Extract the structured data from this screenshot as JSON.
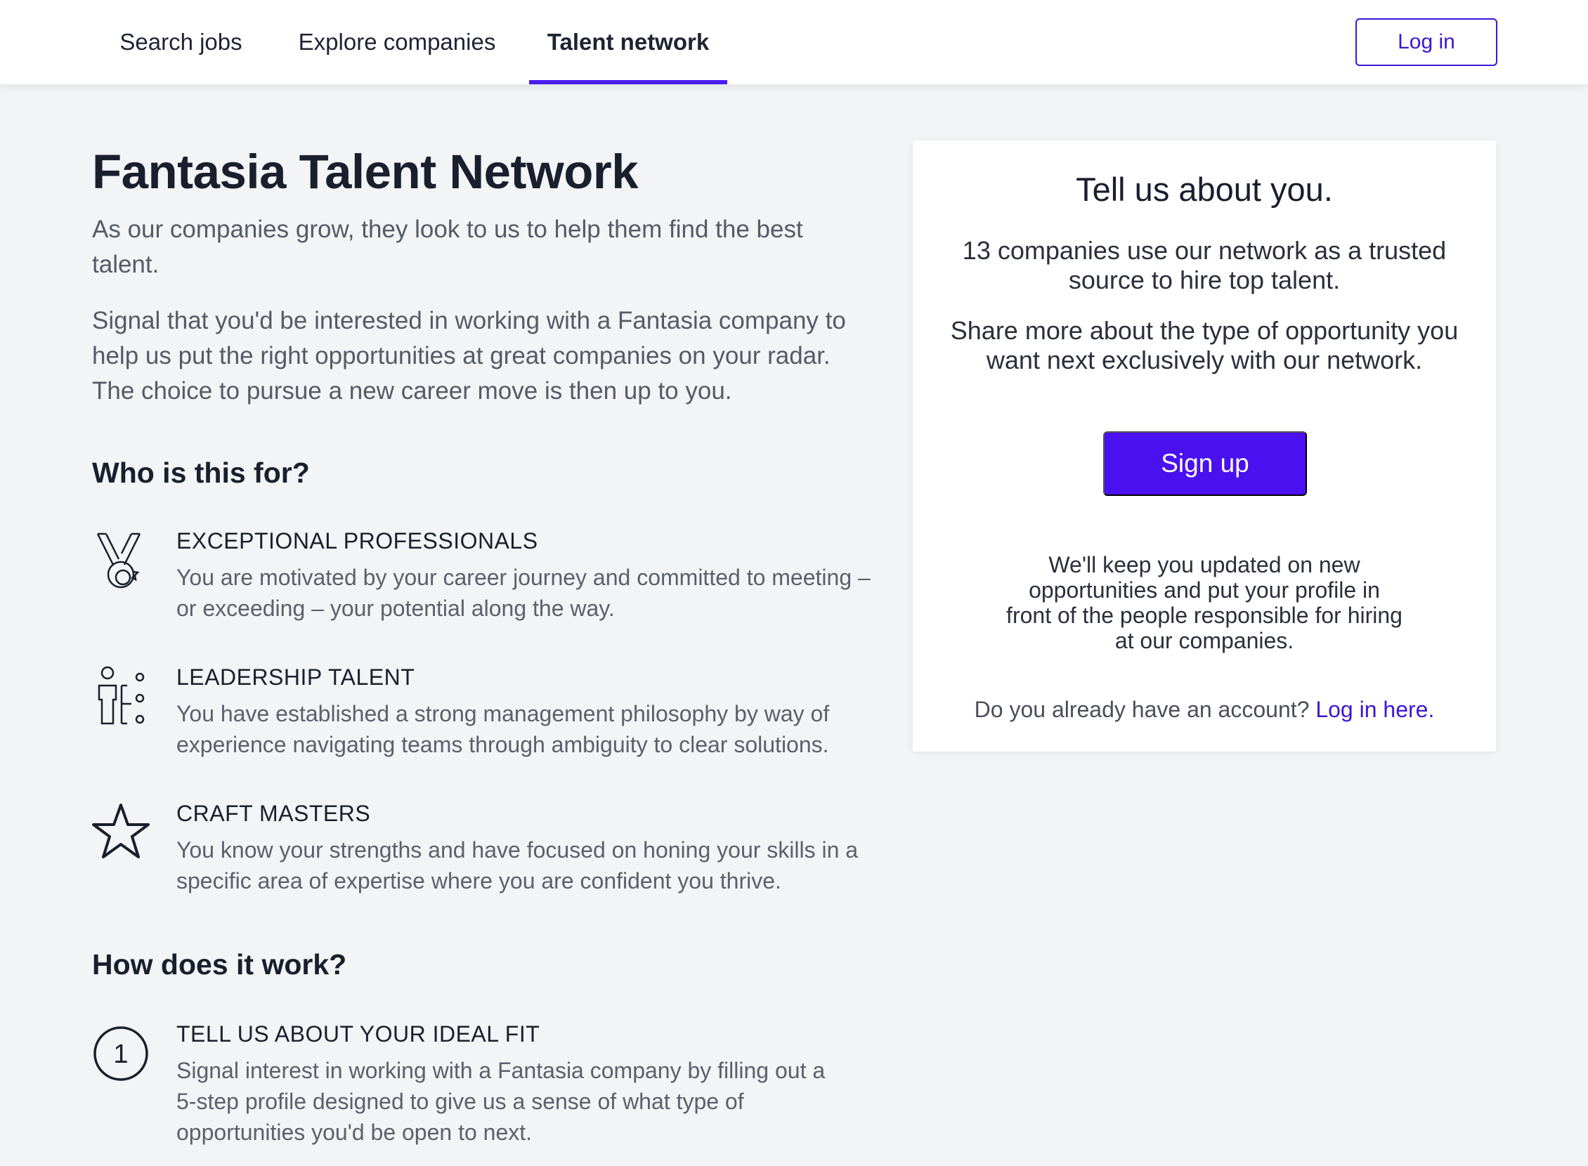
{
  "nav": {
    "tabs": [
      {
        "label": "Search jobs",
        "active": false
      },
      {
        "label": "Explore companies",
        "active": false
      },
      {
        "label": "Talent network",
        "active": true
      }
    ],
    "login_label": "Log in"
  },
  "main": {
    "title": "Fantasia Talent Network",
    "intro_1": "As our companies grow, they look to us to help them find the best talent.",
    "intro_2": "Signal that you'd be interested in working with a Fantasia company to help us put the right opportunities at great companies on your radar. The choice to pursue a new career move is then up to you.",
    "who_heading": "Who is this for?",
    "audiences": [
      {
        "icon": "medal-icon",
        "title": "EXCEPTIONAL PROFESSIONALS",
        "description": "You are motivated by your career journey and committed to meeting – or exceeding – your potential along the way."
      },
      {
        "icon": "leadership-icon",
        "title": "LEADERSHIP TALENT",
        "description": "You have established a strong management philosophy by way of experience navigating teams through ambiguity to clear solutions."
      },
      {
        "icon": "star-icon",
        "title": "CRAFT MASTERS",
        "description": "You know your strengths and have focused on honing your skills in a specific area of expertise where you are confident you thrive."
      }
    ],
    "how_heading": "How does it work?",
    "steps": [
      {
        "number": "1",
        "title": "TELL US ABOUT YOUR IDEAL FIT",
        "description": "Signal interest in working with a Fantasia company by filling out a 5-step profile designed to give us a sense of what type of opportunities you'd be open to next."
      }
    ]
  },
  "card": {
    "title": "Tell us about you.",
    "text_1": "13 companies use our network as a trusted source to hire top talent.",
    "text_2": "Share more about the type of opportunity you want next exclusively with our network.",
    "signup_label": "Sign up",
    "updates_text": "We'll keep you updated on new opportunities and put your profile in front of the people responsible for hiring at our companies.",
    "account_prompt": "Do you already have an account?",
    "login_link": "Log in here."
  },
  "colors": {
    "accent": "#4a10f0",
    "background": "#f3f4f6",
    "text": "#1a1f2e"
  }
}
